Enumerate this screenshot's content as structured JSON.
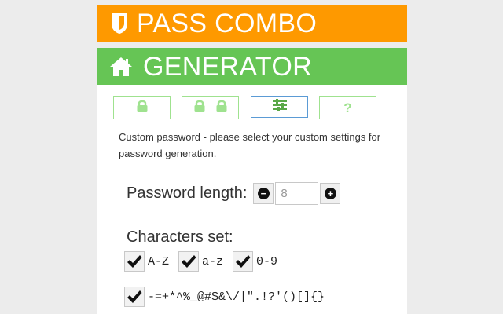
{
  "header": {
    "brand_title": "PASS COMBO",
    "brand_icon": "shield-icon",
    "brand_color": "#fe9900"
  },
  "section": {
    "title": "GENERATOR",
    "icon": "home-icon",
    "color": "#66c555"
  },
  "tabs": [
    {
      "name": "single-lock",
      "icon": "lock-icon"
    },
    {
      "name": "double-lock",
      "icon": "double-lock-icon"
    },
    {
      "name": "custom",
      "icon": "sliders-icon",
      "active": true
    },
    {
      "name": "help",
      "label": "?"
    }
  ],
  "description": "Custom password - please select your custom settings for password generation.",
  "password_length": {
    "label": "Password length:",
    "value": "8",
    "decrement_icon": "minus-circle-icon",
    "increment_icon": "plus-circle-icon"
  },
  "characters_set": {
    "title": "Characters set:",
    "options": [
      {
        "label": "A-Z",
        "checked": true
      },
      {
        "label": "a-z",
        "checked": true
      },
      {
        "label": "0-9",
        "checked": true
      }
    ],
    "symbols": {
      "label": "-=+*^%_@#$&\\/|\".!?'()[]{}",
      "checked": true
    }
  }
}
